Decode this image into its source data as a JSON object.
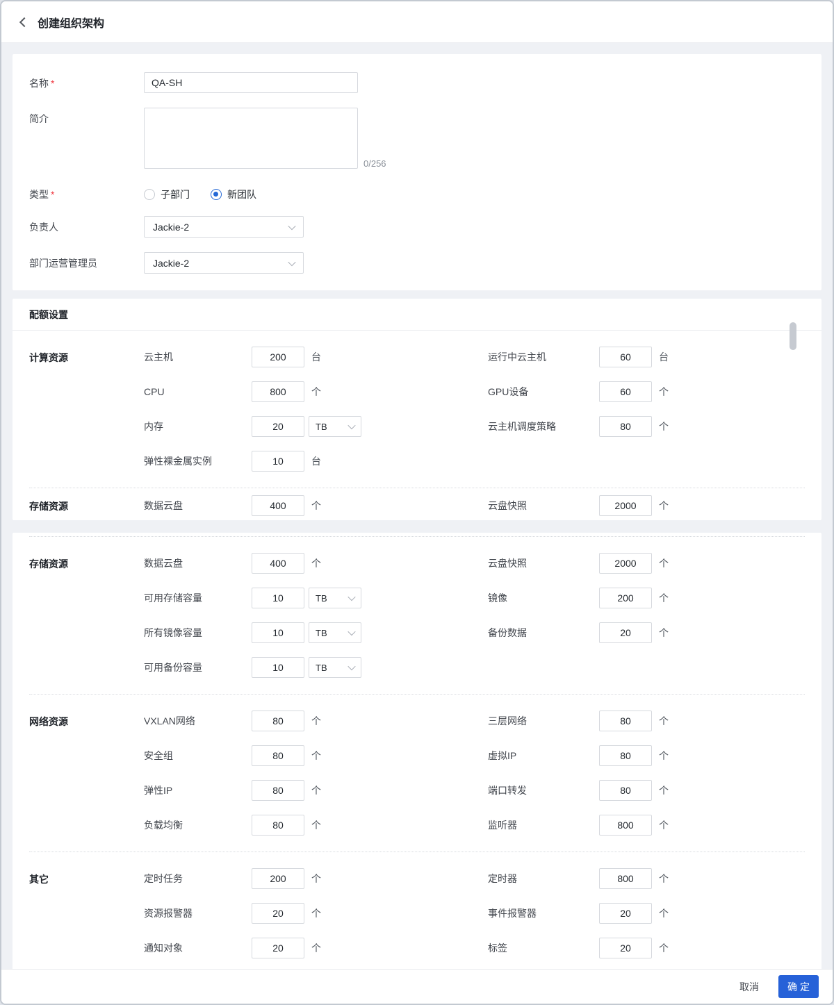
{
  "header": {
    "title": "创建组织架构"
  },
  "required_mark": "*",
  "basic": {
    "name": {
      "label": "名称",
      "value": "QA-SH"
    },
    "intro": {
      "label": "简介",
      "value": "",
      "counter": "0/256"
    },
    "type": {
      "label": "类型",
      "options": [
        {
          "label": "子部门",
          "selected": false
        },
        {
          "label": "新团队",
          "selected": true
        }
      ]
    },
    "owner": {
      "label": "负责人",
      "value": "Jackie-2"
    },
    "admin": {
      "label": "部门运营管理员",
      "value": "Jackie-2"
    }
  },
  "quota_title": "配额设置",
  "quota_panels": [
    {
      "dotted_first": false,
      "sections": [
        {
          "name": "计算资源",
          "rows": [
            {
              "left": {
                "label": "云主机",
                "value": "200",
                "unit": "台"
              },
              "right": {
                "label": "运行中云主机",
                "value": "60",
                "unit": "台"
              }
            },
            {
              "left": {
                "label": "CPU",
                "value": "800",
                "unit": "个"
              },
              "right": {
                "label": "GPU设备",
                "value": "60",
                "unit": "个"
              }
            },
            {
              "left": {
                "label": "内存",
                "value": "20",
                "unit_select": "TB"
              },
              "right": {
                "label": "云主机调度策略",
                "value": "80",
                "unit": "个"
              }
            },
            {
              "left": {
                "label": "弹性裸金属实例",
                "value": "10",
                "unit": "台"
              }
            }
          ]
        },
        {
          "name": "存储资源",
          "clipped": true,
          "rows": [
            {
              "left": {
                "label": "数据云盘",
                "value": "400",
                "unit": "个"
              },
              "right": {
                "label": "云盘快照",
                "value": "2000",
                "unit": "个"
              }
            }
          ]
        }
      ]
    },
    {
      "dotted_first": true,
      "sections": [
        {
          "name": "存储资源",
          "rows": [
            {
              "left": {
                "label": "数据云盘",
                "value": "400",
                "unit": "个"
              },
              "right": {
                "label": "云盘快照",
                "value": "2000",
                "unit": "个"
              }
            },
            {
              "left": {
                "label": "可用存储容量",
                "value": "10",
                "unit_select": "TB"
              },
              "right": {
                "label": "镜像",
                "value": "200",
                "unit": "个"
              }
            },
            {
              "left": {
                "label": "所有镜像容量",
                "value": "10",
                "unit_select": "TB"
              },
              "right": {
                "label": "备份数据",
                "value": "20",
                "unit": "个"
              }
            },
            {
              "left": {
                "label": "可用备份容量",
                "value": "10",
                "unit_select": "TB"
              }
            }
          ]
        },
        {
          "name": "网络资源",
          "rows": [
            {
              "left": {
                "label": "VXLAN网络",
                "value": "80",
                "unit": "个"
              },
              "right": {
                "label": "三层网络",
                "value": "80",
                "unit": "个"
              }
            },
            {
              "left": {
                "label": "安全组",
                "value": "80",
                "unit": "个"
              },
              "right": {
                "label": "虚拟IP",
                "value": "80",
                "unit": "个"
              }
            },
            {
              "left": {
                "label": "弹性IP",
                "value": "80",
                "unit": "个"
              },
              "right": {
                "label": "端口转发",
                "value": "80",
                "unit": "个"
              }
            },
            {
              "left": {
                "label": "负载均衡",
                "value": "80",
                "unit": "个"
              },
              "right": {
                "label": "监听器",
                "value": "800",
                "unit": "个"
              }
            }
          ]
        },
        {
          "name": "其它",
          "rows": [
            {
              "left": {
                "label": "定时任务",
                "value": "200",
                "unit": "个"
              },
              "right": {
                "label": "定时器",
                "value": "800",
                "unit": "个"
              }
            },
            {
              "left": {
                "label": "资源报警器",
                "value": "20",
                "unit": "个"
              },
              "right": {
                "label": "事件报警器",
                "value": "20",
                "unit": "个"
              }
            },
            {
              "left": {
                "label": "通知对象",
                "value": "20",
                "unit": "个"
              },
              "right": {
                "label": "标签",
                "value": "20",
                "unit": "个"
              }
            }
          ]
        }
      ]
    }
  ],
  "footer": {
    "cancel": "取消",
    "ok": "确定"
  },
  "colors": {
    "primary": "#2661d8",
    "required_star": "#f0353d",
    "radio_selected": "#2468d6"
  }
}
